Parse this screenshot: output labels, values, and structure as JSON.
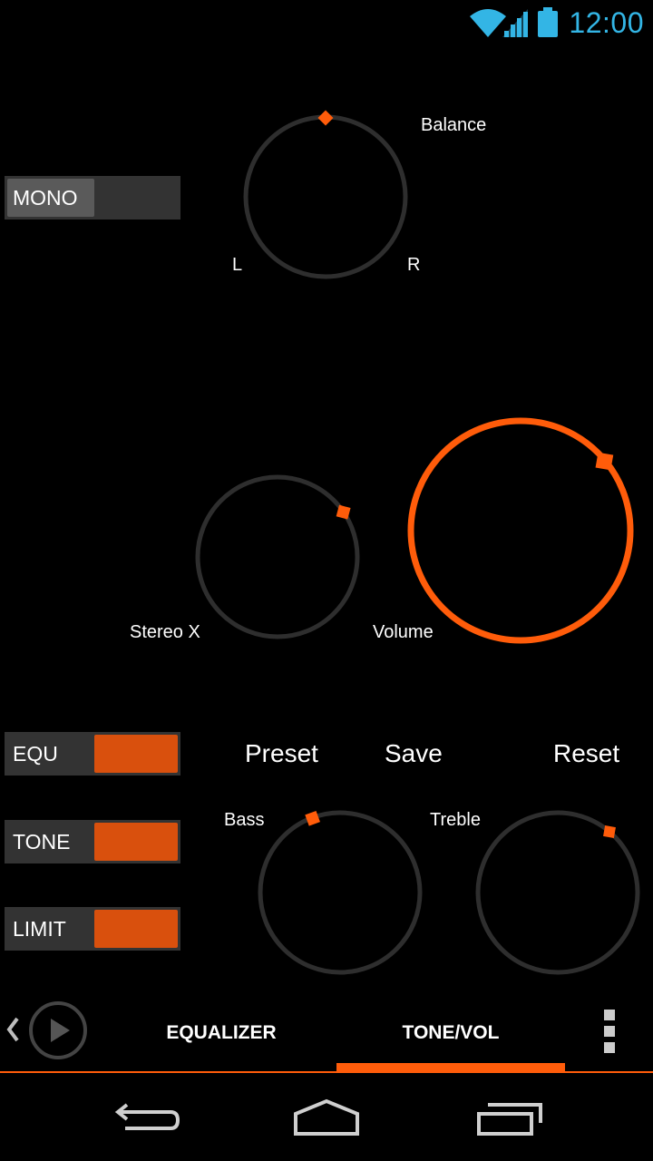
{
  "status_bar": {
    "time": "12:00",
    "icons": [
      "wifi-icon",
      "signal-icon",
      "battery-icon"
    ],
    "accent_color": "#33b5e5"
  },
  "balance": {
    "label": "Balance",
    "left_label": "L",
    "right_label": "R",
    "value_fraction": 0.5
  },
  "mono_toggle": {
    "label": "MONO",
    "state": "off"
  },
  "stereo_x": {
    "label": "Stereo X"
  },
  "volume": {
    "label": "Volume"
  },
  "toggles": [
    {
      "label": "EQU",
      "state": "on"
    },
    {
      "label": "TONE",
      "state": "on"
    },
    {
      "label": "LIMIT",
      "state": "on"
    }
  ],
  "actions": {
    "preset": "Preset",
    "save": "Save",
    "reset": "Reset"
  },
  "bass": {
    "label": "Bass"
  },
  "treble": {
    "label": "Treble"
  },
  "tabs": [
    {
      "label": "EQUALIZER",
      "selected": false
    },
    {
      "label": "TONE/VOL",
      "selected": true
    }
  ],
  "colors": {
    "accent": "#ff5c0a",
    "toggle_on": "#d9500d",
    "knob_ring": "#2e2e2e",
    "background": "#000000"
  }
}
